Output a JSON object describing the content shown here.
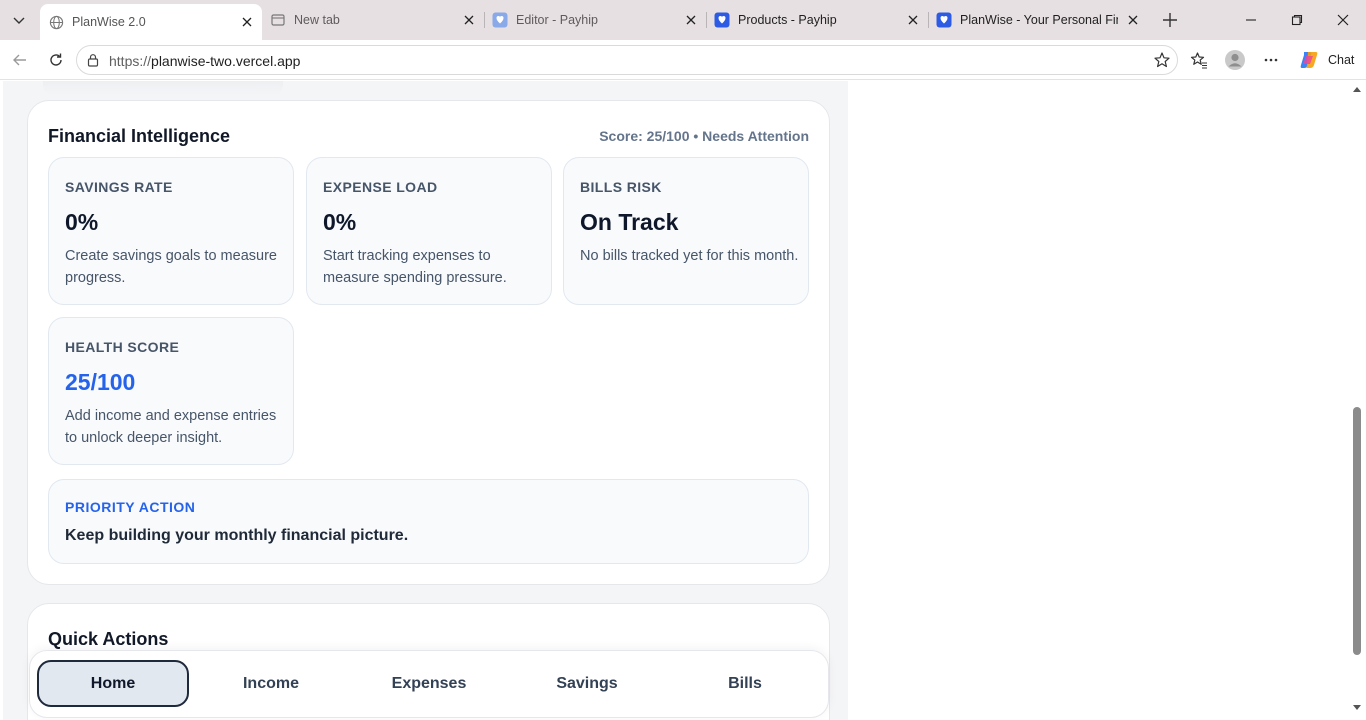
{
  "browser": {
    "tabs": [
      {
        "title": "PlanWise 2.0",
        "icon": "globe-icon",
        "active": true
      },
      {
        "title": "New tab",
        "icon": "newtab-icon",
        "active": false
      },
      {
        "title": "Editor - Payhip",
        "icon": "payhip-icon",
        "active": false
      },
      {
        "title": "Products - Payhip",
        "icon": "payhip-icon",
        "active": false
      },
      {
        "title": "PlanWise - Your Personal Finan",
        "icon": "payhip-icon",
        "active": false
      }
    ],
    "url_scheme": "https://",
    "url_host": "planwise-two.vercel.app",
    "chat_label": "Chat"
  },
  "intelligence": {
    "title": "Financial Intelligence",
    "score_summary": "Score: 25/100 • Needs Attention",
    "metrics": [
      {
        "label": "Savings Rate",
        "value": "0%",
        "description": "Create savings goals to measure progress."
      },
      {
        "label": "Expense Load",
        "value": "0%",
        "description": "Start tracking expenses to measure spending pressure."
      },
      {
        "label": "Bills Risk",
        "value": "On Track",
        "description": "No bills tracked yet for this month."
      },
      {
        "label": "Health Score",
        "value": "25/100",
        "description": "Add income and expense entries to unlock deeper insight."
      }
    ],
    "priority": {
      "label": "Priority Action",
      "text": "Keep building your monthly financial picture."
    }
  },
  "quick_actions": {
    "title": "Quick Actions"
  },
  "bottom_nav": {
    "items": [
      {
        "label": "Home",
        "active": true
      },
      {
        "label": "Income",
        "active": false
      },
      {
        "label": "Expenses",
        "active": false
      },
      {
        "label": "Savings",
        "active": false
      },
      {
        "label": "Bills",
        "active": false
      }
    ]
  },
  "colors": {
    "accent_blue": "#2563eb",
    "page_bg": "#f4f5f7",
    "tabstrip_bg": "#e6e0e2"
  }
}
